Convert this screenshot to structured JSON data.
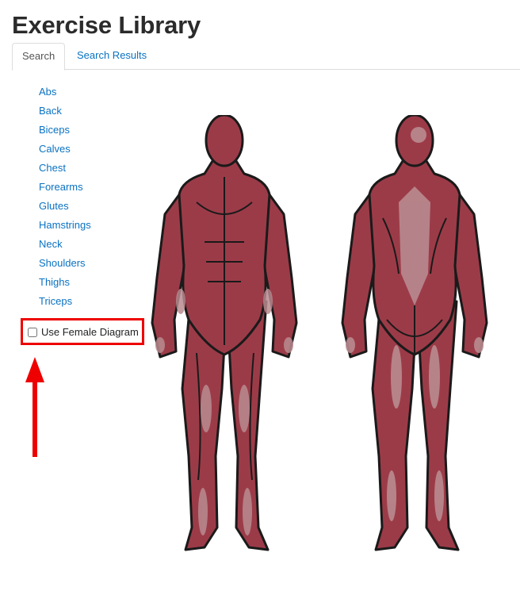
{
  "page": {
    "title": "Exercise Library"
  },
  "tabs": [
    {
      "label": "Search",
      "active": true
    },
    {
      "label": "Search Results",
      "active": false
    }
  ],
  "muscle_groups": [
    "Abs",
    "Back",
    "Biceps",
    "Calves",
    "Chest",
    "Forearms",
    "Glutes",
    "Hamstrings",
    "Neck",
    "Shoulders",
    "Thighs",
    "Triceps"
  ],
  "options": {
    "female_diagram_label": "Use Female Diagram",
    "female_diagram_checked": false
  },
  "colors": {
    "link": "#0a72c2",
    "highlight": "#ee0000",
    "muscle": "#9c3b48",
    "muscle_light": "#b98b90",
    "outline": "#1a1a1a"
  },
  "diagram": {
    "views": [
      "front-body",
      "back-body"
    ]
  },
  "annotation": {
    "arrow_icon": "up-arrow-icon",
    "highlight": "red-rectangle"
  }
}
